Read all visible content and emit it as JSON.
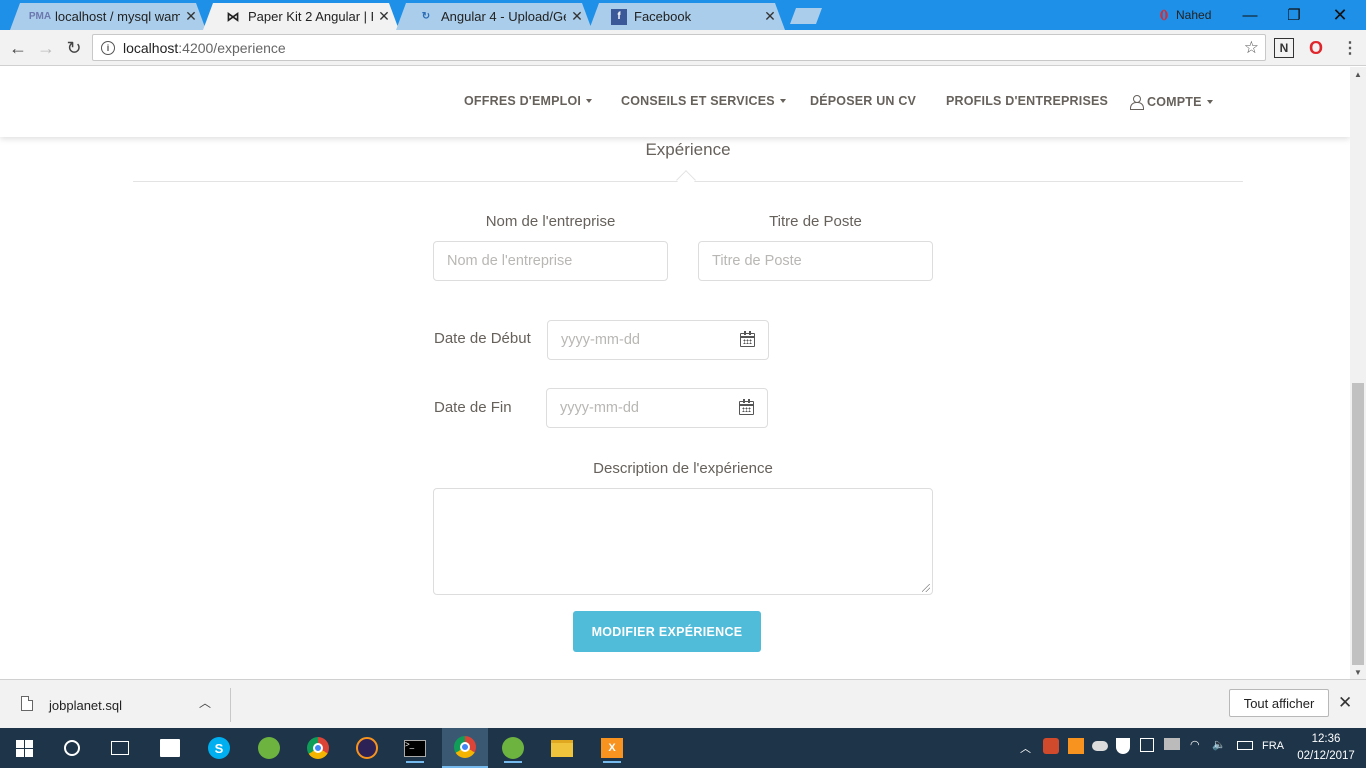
{
  "browser": {
    "tabs": [
      {
        "title": "localhost / mysql wamps",
        "favicon": "phpmyadmin-icon"
      },
      {
        "title": "Paper Kit 2 Angular | Free",
        "favicon": "bowtie-icon"
      },
      {
        "title": "Angular 4 - Upload/Get I",
        "favicon": "loading-icon"
      },
      {
        "title": "Facebook",
        "favicon": "facebook-icon"
      }
    ],
    "active_tab_index": 1,
    "profile_name": "Nahed",
    "url_host": "localhost",
    "url_path": ":4200/experience"
  },
  "site_nav": {
    "items": [
      {
        "label": "OFFRES D'EMPLOI",
        "dropdown": true
      },
      {
        "label": "CONSEILS ET SERVICES",
        "dropdown": true
      },
      {
        "label": "DÉPOSER UN CV",
        "dropdown": false
      },
      {
        "label": "PROFILS D'ENTREPRISES",
        "dropdown": false
      }
    ],
    "account_label": "COMPTE"
  },
  "form": {
    "section_title": "Expérience",
    "company_label": "Nom de l'entreprise",
    "company_placeholder": "Nom de l'entreprise",
    "job_title_label": "Titre de Poste",
    "job_title_placeholder": "Titre de Poste",
    "start_date_label": "Date de Début",
    "start_date_placeholder": "yyyy-mm-dd",
    "end_date_label": "Date de Fin",
    "end_date_placeholder": "yyyy-mm-dd",
    "description_label": "Description de l'expérience",
    "description_value": "",
    "submit_label": "MODIFIER EXPÉRIENCE"
  },
  "download_shelf": {
    "file_name": "jobplanet.sql",
    "show_all_label": "Tout afficher"
  },
  "taskbar": {
    "language": "FRA",
    "time": "12:36",
    "date": "02/12/2017"
  },
  "colors": {
    "tabstrip": "#1e90e8",
    "button_info": "#51bcda",
    "nav_text": "#66615b",
    "taskbar": "#1e3449"
  }
}
